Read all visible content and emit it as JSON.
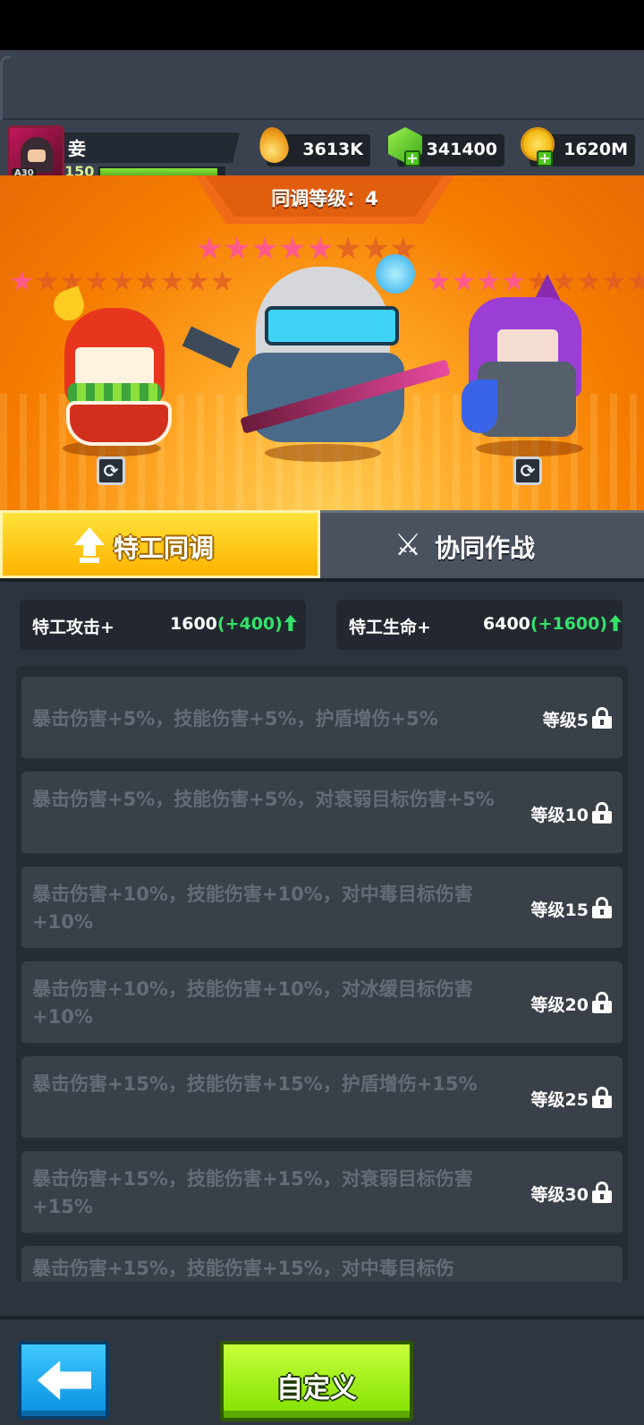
{
  "header": {
    "player_name": "妾",
    "player_level": "150",
    "avatar_badge": "A30",
    "xp_progress": 0.95,
    "resources": [
      {
        "name": "oil-drop",
        "value": "3613K"
      },
      {
        "name": "gem",
        "value": "341400"
      },
      {
        "name": "gold-coin",
        "value": "1620M"
      }
    ]
  },
  "banner": {
    "sync_level_text": "同调等级：4",
    "left_stars": {
      "filled": 1,
      "total": 9
    },
    "center_stars": {
      "filled": 5,
      "total": 8
    },
    "right_stars": {
      "filled": 4,
      "total": 9
    }
  },
  "tabs": [
    {
      "label": "特工同调",
      "active": true
    },
    {
      "label": "协同作战",
      "active": false
    }
  ],
  "stats": [
    {
      "label": "特工攻击+",
      "value": "1600",
      "bonus": "(+400)"
    },
    {
      "label": "特工生命+",
      "value": "6400",
      "bonus": "(+1600)"
    }
  ],
  "bonuses": [
    {
      "text": "暴击伤害+5%，技能伤害+5%，护盾增伤+5%",
      "req": "等级5"
    },
    {
      "text": "暴击伤害+5%，技能伤害+5%，对衰弱目标伤害+5%",
      "req": "等级10"
    },
    {
      "text": "暴击伤害+10%，技能伤害+10%，对中毒目标伤害+10%",
      "req": "等级15"
    },
    {
      "text": "暴击伤害+10%，技能伤害+10%，对冰缓目标伤害+10%",
      "req": "等级20"
    },
    {
      "text": "暴击伤害+15%，技能伤害+15%，护盾增伤+15%",
      "req": "等级25"
    },
    {
      "text": "暴击伤害+15%，技能伤害+15%，对衰弱目标伤害+15%",
      "req": "等级30"
    },
    {
      "text": "暴击伤害+15%，技能伤害+15%，对中毒目标伤",
      "req": ""
    }
  ],
  "footer": {
    "custom_label": "自定义"
  },
  "colors": {
    "tab_active": "#ffc21a",
    "bonus_green": "#33e36a",
    "back_button": "#1aa8f0",
    "custom_button": "#9ef01a"
  }
}
